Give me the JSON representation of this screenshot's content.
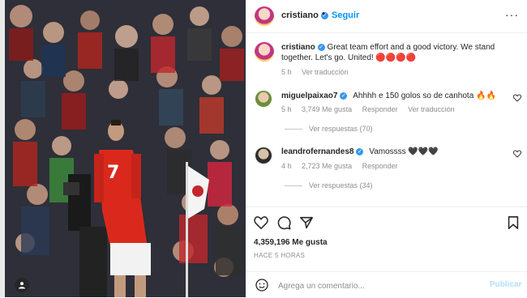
{
  "post": {
    "author": "cristiano",
    "follow_label": "Seguir",
    "more_label": "···",
    "caption_text": "Great team effort and a good victory. We stand together. Let's go. United! 🔴🔴🔴🔴",
    "caption_time": "5 h",
    "caption_translate": "Ver traducción"
  },
  "comments": [
    {
      "user": "miguelpaixao7",
      "text": "Ahhhh e 150 golos so de canhota 🔥🔥",
      "time": "5 h",
      "likes": "3,749 Me gusta",
      "reply": "Responder",
      "translate": "Ver traducción",
      "view_replies": "Ver respuestas (70)"
    },
    {
      "user": "leandrofernandes8",
      "text": "Vamossss 🖤🖤🖤",
      "time": "4 h",
      "likes": "2,723 Me gusta",
      "reply": "Responder",
      "translate": "",
      "view_replies": "Ver respuestas (34)"
    }
  ],
  "stats": {
    "likes": "4,359,196 Me gusta",
    "time_ago": "HACE 5 HORAS"
  },
  "comment_box": {
    "placeholder": "Agrega un comentario...",
    "publish_label": "Publicar"
  },
  "colors": {
    "accent": "#0095f6",
    "verified": "#3897f0",
    "muted": "#8e8e8e",
    "jersey": "#da291c"
  },
  "icons": [
    "heart-icon",
    "comment-icon",
    "share-icon",
    "bookmark-icon",
    "emoji-icon",
    "user-tag-icon",
    "verified-icon",
    "more-icon"
  ]
}
